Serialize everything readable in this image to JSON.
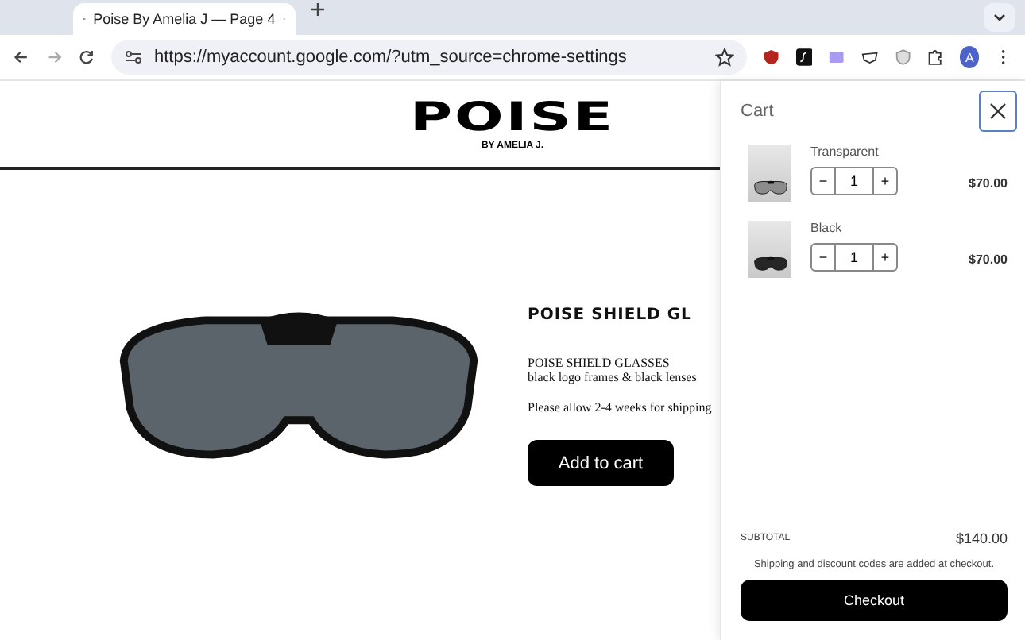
{
  "browser": {
    "tab_title": "Poise By Amelia J — Page 4",
    "address": "https://myaccount.google.com/?utm_source=chrome-settings",
    "profile_initial": "A"
  },
  "store": {
    "logo": "POISE",
    "logo_sub": "BY AMELIA J.",
    "product": {
      "heading": "POISE SHIELD GL",
      "name": "POISE SHIELD GLASSES",
      "description": "black logo frames & black lenses",
      "shipping_note": "Please allow 2-4 weeks for shipping",
      "button": "Add to cart"
    }
  },
  "cart": {
    "title": "Cart",
    "items": [
      {
        "variant": "Transparent",
        "color": "#8c8c8c",
        "decrease": "−",
        "quantity": "1",
        "increase": "+",
        "price": "$70.00"
      },
      {
        "variant": "Black",
        "color": "#262626",
        "decrease": "−",
        "quantity": "1",
        "increase": "+",
        "price": "$70.00"
      }
    ],
    "subtotal_label": "SUBTOTAL",
    "subtotal": "$140.00",
    "note": "Shipping and discount codes are added at checkout.",
    "checkout": "Checkout"
  }
}
